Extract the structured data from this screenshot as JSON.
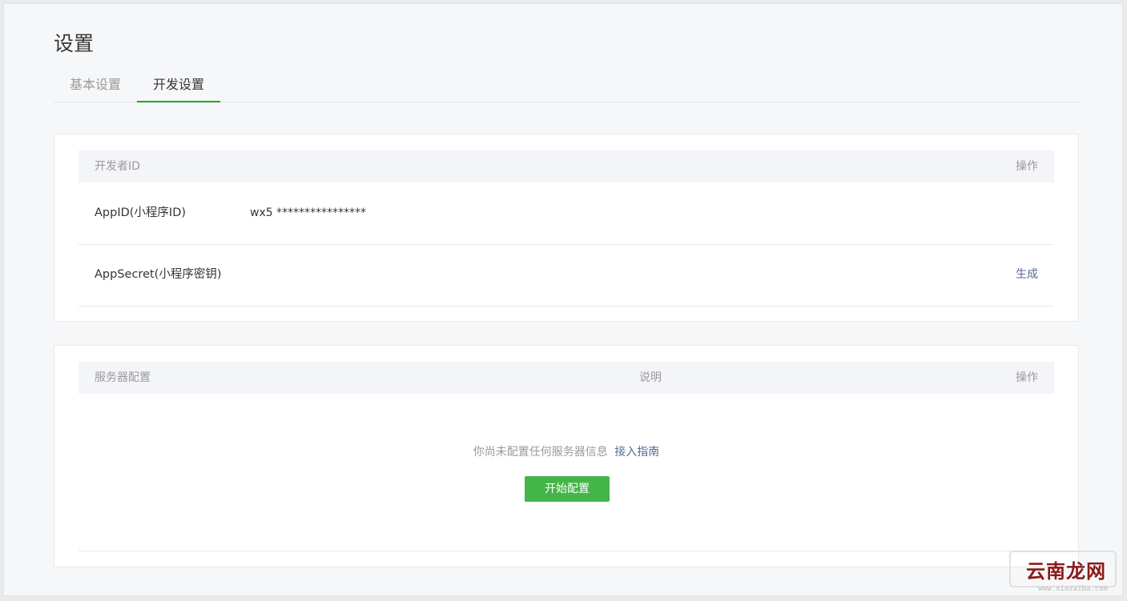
{
  "page": {
    "title": "设置"
  },
  "tabs": [
    {
      "label": "基本设置",
      "active": false
    },
    {
      "label": "开发设置",
      "active": true
    }
  ],
  "developer_id": {
    "header": {
      "col1": "开发者ID",
      "col_action": "操作"
    },
    "rows": [
      {
        "label": "AppID(小程序ID)",
        "value": "wx5 ****************",
        "action": ""
      },
      {
        "label": "AppSecret(小程序密钥)",
        "value": "",
        "action": "生成"
      }
    ]
  },
  "server_config": {
    "header": {
      "col1": "服务器配置",
      "col2": "说明",
      "col_action": "操作"
    },
    "empty_message": "你尚未配置任何服务器信息",
    "guide_link": "接入指南",
    "start_button": "开始配置"
  },
  "watermark": {
    "text": "云南龙网",
    "url": "www.xiazaiba.com"
  },
  "colors": {
    "accent_green": "#44b549",
    "tab_green": "#1aad19",
    "link_blue": "#576b95"
  }
}
